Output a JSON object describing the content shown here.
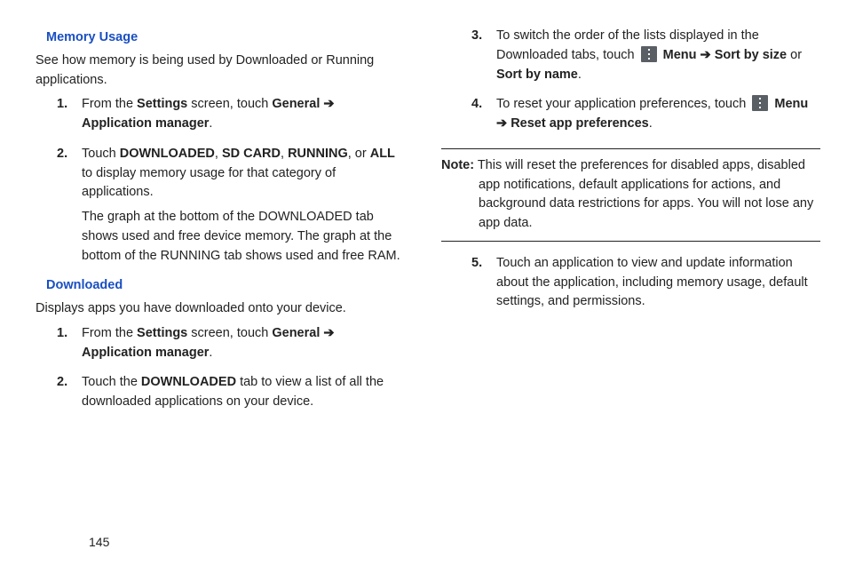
{
  "pageNumber": "145",
  "left": {
    "memoryUsage": {
      "heading": "Memory Usage",
      "intro": "See how memory is being used by Downloaded or Running applications.",
      "items": [
        {
          "num": "1.",
          "pre": "From the ",
          "b1": "Settings",
          "mid1": " screen, touch ",
          "b2": "General",
          "arrow": " ➔ ",
          "b3": "Application manager",
          "post": "."
        },
        {
          "num": "2.",
          "pre": "Touch ",
          "b1": "DOWNLOADED",
          "c1": ", ",
          "b2": "SD CARD",
          "c2": ", ",
          "b3": "RUNNING",
          "c3": ", or ",
          "b4": "ALL",
          "post": " to display memory usage for that category of applications.",
          "extra": "The graph at the bottom of the DOWNLOADED tab shows used and free device memory. The graph at the bottom of the RUNNING tab shows used and free RAM."
        }
      ]
    },
    "downloaded": {
      "heading": "Downloaded",
      "intro": "Displays apps you have downloaded onto your device.",
      "items": [
        {
          "num": "1.",
          "pre": "From the ",
          "b1": "Settings",
          "mid1": " screen, touch ",
          "b2": "General",
          "arrow": " ➔ ",
          "b3": "Application manager",
          "post": "."
        },
        {
          "num": "2.",
          "pre": "Touch the ",
          "b1": "DOWNLOADED",
          "post": " tab to view a list of all the downloaded applications on your device."
        }
      ]
    }
  },
  "right": {
    "continued": [
      {
        "num": "3.",
        "pre": "To switch the order of the lists displayed in the Downloaded tabs, touch ",
        "menuLabel": "Menu",
        "arrow": " ➔ ",
        "b1": "Sort by size",
        "mid": " or ",
        "b2": "Sort by name",
        "post": "."
      },
      {
        "num": "4.",
        "pre": "To reset your application preferences, touch ",
        "menuLabel": "Menu",
        "arrow": " ➔ ",
        "b1": "Reset app preferences",
        "post": "."
      }
    ],
    "note": {
      "label": "Note:",
      "text": " This will reset the preferences for disabled apps, disabled app notifications, default applications for actions, and background data restrictions for apps. You will not lose any app data."
    },
    "after": [
      {
        "num": "5.",
        "text": "Touch an application to view and update information about the application, including memory usage, default settings, and permissions."
      }
    ]
  }
}
